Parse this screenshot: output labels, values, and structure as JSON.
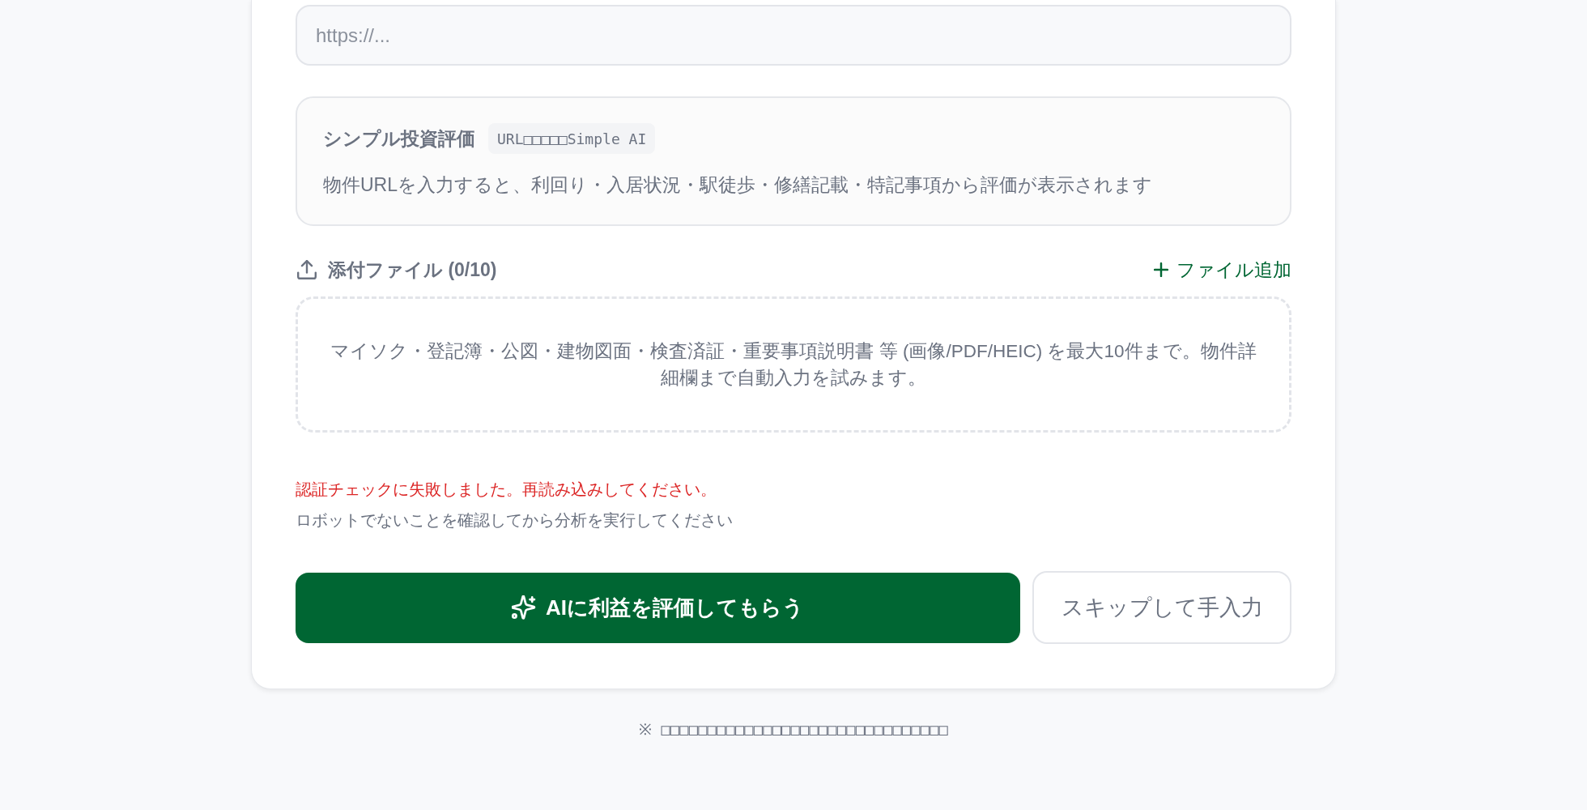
{
  "url_field": {
    "placeholder": "https://..."
  },
  "simple_evaluation": {
    "title": "シンプル投資評価",
    "badge": "URL□□□□□Simple AI",
    "description": "物件URLを入力すると、利回り・入居状況・駅徒歩・修繕記載・特記事項から評価が表示されます"
  },
  "attachments": {
    "label": "添付ファイル (0/10)",
    "add_button": "ファイル追加",
    "dropzone_text": "マイソク・登記簿・公図・建物図面・検査済証・重要事項説明書 等 (画像/PDF/HEIC) を最大10件まで。物件詳細欄まで自動入力を試みます。"
  },
  "messages": [
    {
      "kind": "error",
      "text": "認証チェックに失敗しました。再読み込みしてください。"
    },
    {
      "kind": "hint",
      "text": "ロボットでないことを確認してから分析を実行してください"
    }
  ],
  "buttons": [
    {
      "kind": "primary",
      "label": "AIに利益を評価してもらう"
    },
    {
      "kind": "secondary",
      "label": "スキップして手入力"
    }
  ],
  "footer_note": "※ □□□□□□□□□□□□□□□□□□□□□□□□□□□□□□□"
}
